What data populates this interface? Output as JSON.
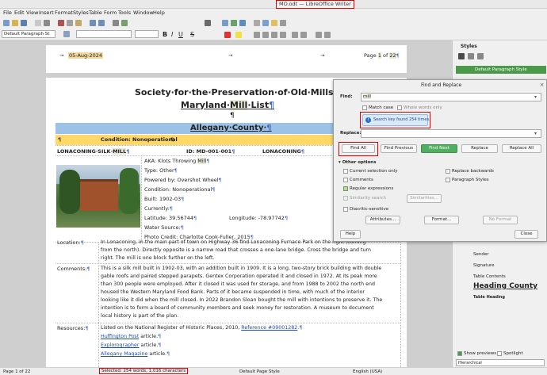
{
  "window": {
    "title": "MO.odt — LibreOffice Writer"
  },
  "menu": [
    "File",
    "Edit",
    "View",
    "Insert",
    "Format",
    "Styles",
    "Table",
    "Form",
    "Tools",
    "Window",
    "Help"
  ],
  "toolbar": {
    "paragraph_style": "Default Paragraph St"
  },
  "header": {
    "date": "05-Aug-2024",
    "page_label": "Page",
    "page_num": "1",
    "page_of": "of",
    "page_total": "22"
  },
  "document": {
    "title_line1": "Society·for·the·Preservation·of·Old·Mills",
    "title_line2_pre": "Maryland·",
    "title_line2_hl": "Mill",
    "title_line2_post": "·List",
    "county_heading": "Allegany·County·",
    "condition_bar": "Condition: Nonoperational",
    "row_name_pre": "LONACONING·SILK·",
    "row_name_hl": "MILL",
    "row_id": "ID: MD-001-001",
    "row_loc": "LONACONING",
    "aka_pre": "AKA: Klots Throwing ",
    "aka_hl": "Mill",
    "type": "Type: Other",
    "power": "Powered by: Overshot Wheel",
    "condition": "Condition: Nonoperational",
    "built": "Built: 1902-03",
    "currently": "Currently:",
    "latitude": "Latitude: 39.56744",
    "longitude": "Longitude: -78.97742",
    "water": "Water Source:",
    "photo_credit": "Photo Credit: Charlotte Cook-Fuller, 2015",
    "location_label": "Location:",
    "location_text": [
      "In Lonaconing, in the main part of town on Highway 36 find Lonaconing Furnace Park on the right (coming",
      "from the north). Directly opposite is a narrow road that crosses a one-lane bridge. Cross the bridge and turn",
      "right. The mill is one block further on the left."
    ],
    "comments_label": "Comments:",
    "comments_text": [
      "This is a silk mill built in 1902-03, with an addition built in 1909. It is a long, two-story brick building with double",
      "gable roofs and paired stepped parapets. Gentex Corporation operated it and closed in 1972. At its peak more",
      "than 300 people were employed. After it closed it was used for storage, and from 1988 to 2002 the north end",
      "housed the Western Maryland Food Bank. Parts of it became suspended in time, with much of the interior",
      "looking like it did when the mill closed. In 2022 Brandon Sloan bought the mill with intentions to preserve it. The",
      "intention is to form a board of community members and seek money for restoration. A museum to document",
      "local history is part of the plan."
    ],
    "resources_label": "Resources:",
    "resources_line1_pre": "Listed on the National Register of Historic Places, 2010, ",
    "resources_line1_link": "Reference #09001282",
    "resources_line1_post": ".",
    "res_link1": "Huffington Post",
    "res_link2": "Explorographer",
    "res_link3": "Allegany Magazine",
    "res_article": " article."
  },
  "dialog": {
    "title": "Find and Replace",
    "find_label": "Find:",
    "find_value": "mill",
    "match_case": "Match case",
    "whole_words": "Whole words only",
    "info": "Search key found 254 times.",
    "replace_label": "Replace:",
    "find_all": "Find All",
    "find_previous": "Find Previous",
    "find_next": "Find Next",
    "replace": "Replace",
    "replace_all": "Replace All",
    "other_options": "Other options",
    "current_selection": "Current selection only",
    "replace_backwards": "Replace backwards",
    "comments": "Comments",
    "paragraph_styles": "Paragraph Styles",
    "regex": "Regular expressions",
    "similarity_search": "Similarity search",
    "similarities": "Similarities...",
    "diacritic": "Diacritic-sensitive",
    "attributes": "Attributes...",
    "format": "Format...",
    "no_format": "No Format",
    "help": "Help",
    "close": "Close"
  },
  "sidebar": {
    "title": "Styles",
    "selected_style": "Default Paragraph Style",
    "items": [
      "Sender",
      "Signature",
      "Table Contents"
    ],
    "heading_county": "Heading County",
    "table_heading": "Table Heading",
    "show_previews": "Show previews",
    "spotlight": "Spotlight",
    "filter": "Hierarchical"
  },
  "status": {
    "page": "Page 1 of 22",
    "selection": "Selected: 254 words, 1,016 characters",
    "page_style": "Default Page Style",
    "language": "English (USA)"
  }
}
